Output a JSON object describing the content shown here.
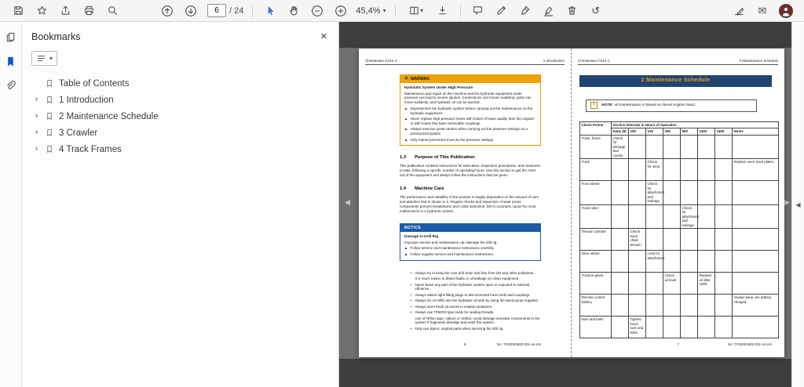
{
  "toolbar": {
    "page_input": "6",
    "page_total": "/ 24",
    "zoom_value": "45,4%"
  },
  "bookmarks_panel": {
    "title": "Bookmarks",
    "items": [
      {
        "label": "Table of Contents"
      },
      {
        "label": "1 Introduction"
      },
      {
        "label": "2 Maintenance Schedule"
      },
      {
        "label": "3 Crawler"
      },
      {
        "label": "4 Track Frames"
      }
    ]
  },
  "pages": {
    "left": {
      "header_left": "Christensen CS14 C",
      "header_right": "1 Introduction",
      "warning_box": {
        "label": "WARNING",
        "title": "Hydraulic System Under High Pressure",
        "intro": "Maintenance and repair on the machine and the hydraulic equipment under pressure can lead to severe injuries. Connections can loosen suddenly, parts can move suddenly, and hydraulic oil can be ejected.",
        "bullets": [
          "Depressurize the hydraulic system before carrying out the maintenance on the hydraulic equipment.",
          "Never replace high-pressure hoses with hoses of lower quality than the original or with hoses that have removable couplings.",
          "Always exercise great caution when carrying out the pressure settings on a pressurized system.",
          "Only trained personnel must do the pressure settings."
        ]
      },
      "section_13": {
        "number": "1.3",
        "title": "Purpose of This Publication",
        "body": "This publication contains instructions for lubrication, inspection procedures, and measures to take, following a specific number of operating hours. Use this section to get the most out of the equipment and always follow the instructions that are given."
      },
      "section_14": {
        "number": "1.4",
        "title": "Machine Care",
        "body": "The performance and reliability of the product is largely dependent on the amount of care and attention that is shown to it. Regular checks and inspection of wear prone components prevent breakdowns and costly downtime. Dirt is a primary cause for most malfunctions in a hydraulic system."
      },
      "notice_box": {
        "label": "NOTICE",
        "title": "Damage to Drill Rig",
        "intro": "Improper service and maintenance can damage the drill rig.",
        "bullets": [
          "Follow service and maintenance instructions carefully.",
          "Follow supplier service and maintenance instructions."
        ]
      },
      "care_list": [
        {
          "m": "•",
          "t": "Always try to keep the core drill clean and free from dirt and other pollutants."
        },
        {
          "m": "",
          "t": "It is much easier to detect faults or oil leakage on clean equipment."
        },
        {
          "m": "•",
          "t": "Never leave any part of the hydraulic system open or exposed to external influence."
        },
        {
          "m": "•",
          "t": "Always attach tight-fitting plugs to disconnected hose ends and couplings."
        },
        {
          "m": "•",
          "t": "Always do oil refills into the hydraulic oil tank by using the hand pump supplied."
        },
        {
          "m": "•",
          "t": "Always store fresh oil stocks in sealed containers."
        },
        {
          "m": "•",
          "t": "Always use TREDO-type seals for sealing threads."
        },
        {
          "m": "",
          "t": "Use of Teflon tape, oakum or similar, could damage sensitive components in the system if fragments dislodge and enter the system."
        },
        {
          "m": "•",
          "t": "Only use Epiroc original parts when servicing the drill rig."
        }
      ],
      "page_number": "6",
      "doc_number": "No: TIG0001692.001 en-US"
    },
    "right": {
      "header_left": "Christensen CS14 C",
      "header_right": "2 Maintenance Schedule",
      "chapter_banner": "2 Maintenance Schedule",
      "note": {
        "prefix": "NOTE:",
        "text": "All maintenance is based on diesel engine hours."
      },
      "maintenance_table": {
        "corner": "Check Points",
        "group_header": "Service Intervals in Hours of Operation",
        "columns": [
          "Daily (8)",
          "100",
          "125",
          "250",
          "500",
          "1000",
          "1500",
          "Notes"
        ],
        "rows": [
          [
            "Track, frame",
            "Check for damage and cracks.",
            "",
            "",
            "",
            "",
            "",
            "",
            ""
          ],
          [
            "Track",
            "",
            "",
            "Check for wear.",
            "",
            "",
            "",
            "",
            "Replace worn track plates."
          ],
          [
            "Front wheel",
            "",
            "",
            "Check for attachment and leakage.",
            "",
            "",
            "",
            "",
            ""
          ],
          [
            "Track roller",
            "",
            "",
            "",
            "",
            "Check for attachment and leakage.",
            "",
            "",
            ""
          ],
          [
            "Tension cylinder",
            "",
            "Check track chain tension.",
            "",
            "",
            "",
            "",
            "",
            ""
          ],
          [
            "Drive wheel",
            "",
            "",
            "Look for attachment.",
            "",
            "",
            "",
            "",
            ""
          ],
          [
            "Traction gears",
            "",
            "",
            "",
            "Check oil level.",
            "",
            "Replace oil after 100h.",
            "",
            ""
          ],
          [
            "Remote control battery",
            "",
            "",
            "",
            "",
            "",
            "",
            "",
            "Always keep one battery charged."
          ],
          [
            "Nuts and bolts",
            "",
            "Tighten loose nuts and bolts.",
            "",
            "",
            "",
            "",
            "",
            ""
          ]
        ]
      },
      "page_number": "7",
      "doc_number": "No: TIG0001692.001 en-US"
    }
  },
  "colors": {
    "warning_orange": "#F0A202",
    "notice_blue": "#1D5CA6",
    "banner_navy": "#1F4570",
    "banner_text_orange": "#F59C1B",
    "select_tool_blue": "#2F7BDE",
    "avatar_maroon": "#7C2626"
  }
}
